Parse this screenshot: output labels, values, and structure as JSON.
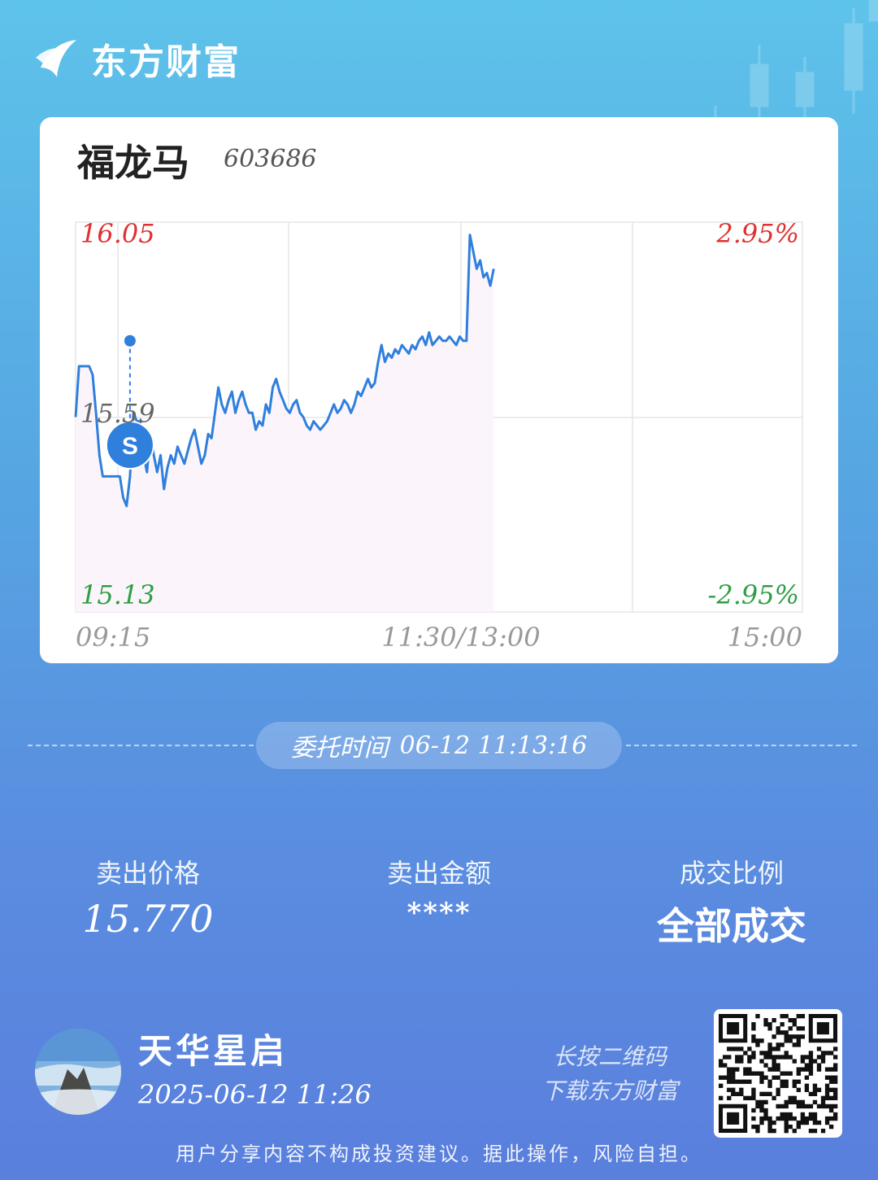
{
  "brand": {
    "name": "东方财富",
    "logo_icon": "eastmoney-logo-icon"
  },
  "stock": {
    "name": "福龙马",
    "code": "603686"
  },
  "chart_data": {
    "type": "line",
    "y_labels": {
      "top_left": "16.05",
      "mid_left": "15.59",
      "bottom_left": "15.13",
      "top_right": "2.95%",
      "bottom_right": "-2.95%"
    },
    "x_labels": [
      "09:15",
      "11:30/13:00",
      "15:00"
    ],
    "ylim": [
      15.13,
      16.05
    ],
    "baseline": 15.59,
    "grid": true,
    "series": [
      {
        "values": [
          15.59,
          15.71,
          15.71,
          15.71,
          15.71,
          15.69,
          15.6,
          15.5,
          15.45,
          15.45,
          15.45,
          15.45,
          15.45,
          15.45,
          15.4,
          15.38,
          15.45,
          15.6,
          15.58,
          15.58,
          15.5,
          15.46,
          15.55,
          15.5,
          15.46,
          15.5,
          15.42,
          15.47,
          15.5,
          15.48,
          15.52,
          15.5,
          15.48,
          15.51,
          15.54,
          15.56,
          15.52,
          15.48,
          15.5,
          15.55,
          15.54,
          15.6,
          15.66,
          15.62,
          15.6,
          15.63,
          15.65,
          15.6,
          15.63,
          15.65,
          15.62,
          15.6,
          15.6,
          15.56,
          15.58,
          15.57,
          15.62,
          15.6,
          15.66,
          15.68,
          15.65,
          15.63,
          15.61,
          15.6,
          15.62,
          15.63,
          15.6,
          15.59,
          15.57,
          15.56,
          15.58,
          15.57,
          15.56,
          15.57,
          15.58,
          15.6,
          15.62,
          15.6,
          15.61,
          15.63,
          15.62,
          15.6,
          15.62,
          15.65,
          15.64,
          15.66,
          15.68,
          15.66,
          15.67,
          15.72,
          15.76,
          15.72,
          15.74,
          15.73,
          15.75,
          15.74,
          15.76,
          15.75,
          15.74,
          15.76,
          15.75,
          15.77,
          15.78,
          15.76,
          15.79,
          15.76,
          15.77,
          15.78,
          15.77,
          15.77,
          15.78,
          15.77,
          15.76,
          15.78,
          15.77,
          15.77,
          16.02,
          15.98,
          15.94,
          15.96,
          15.92,
          15.93,
          15.9,
          15.94
        ]
      }
    ],
    "trade_marker": {
      "label": "S",
      "price": 15.77
    }
  },
  "order": {
    "time_label": "委托时间",
    "time_value": "06-12 11:13:16"
  },
  "stats": [
    {
      "title": "卖出价格",
      "value": "15.770"
    },
    {
      "title": "卖出金额",
      "value": "****"
    },
    {
      "title": "成交比例",
      "value": "全部成交"
    }
  ],
  "user": {
    "name": "天华星启",
    "time": "2025-06-12 11:26",
    "avatar_icon": "mountain-avatar-icon"
  },
  "qr": {
    "hint_line1": "长按二维码",
    "hint_line2": "下载东方财富",
    "icon": "qr-code-icon"
  },
  "disclaimer": "用户分享内容不构成投资建议。据此操作，风险自担。",
  "colors": {
    "up": "#e03131",
    "down": "#2f9e44",
    "line": "#2f7fdc",
    "accent": "#2f7fdc"
  }
}
